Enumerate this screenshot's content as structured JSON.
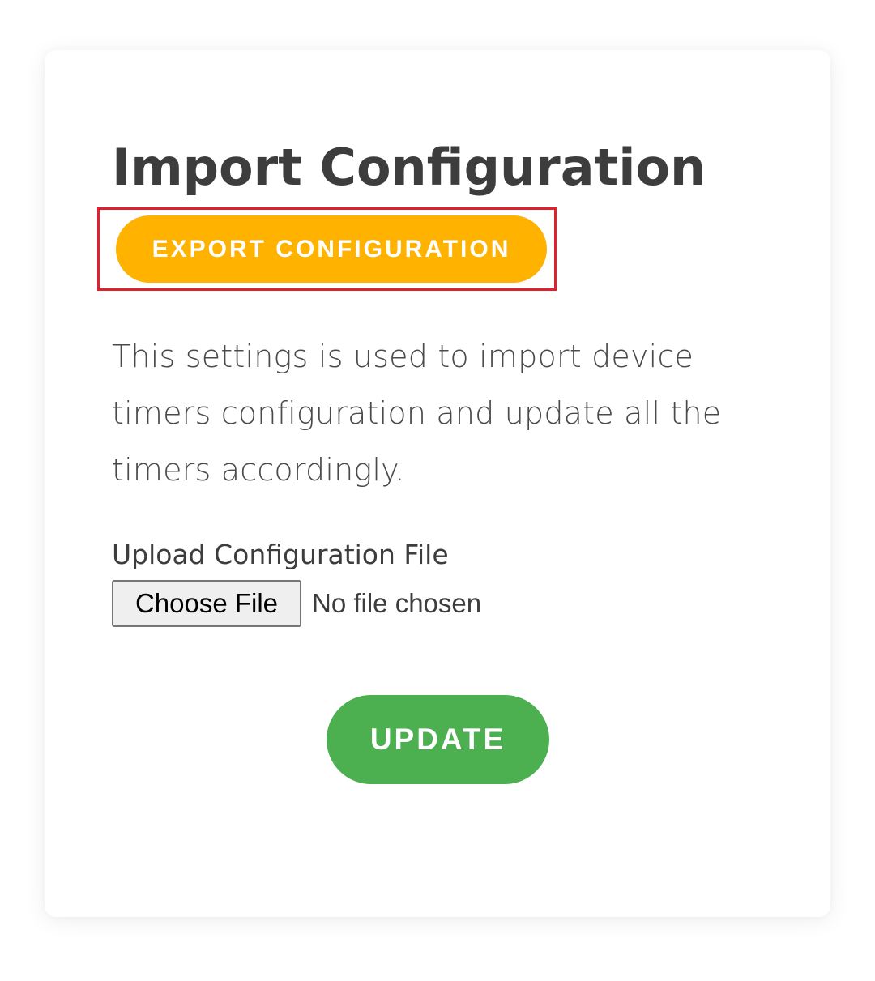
{
  "card": {
    "title": "Import Configuration",
    "export_button_label": "EXPORT CONFIGURATION",
    "description": "This settings is used to import device timers configuration and update all the timers accordingly.",
    "upload_label": "Upload Configuration File",
    "file_input": {
      "choose_button_label": "Choose File",
      "status_text": "No file chosen"
    },
    "update_button_label": "UPDATE"
  },
  "colors": {
    "export_button": "#ffb300",
    "update_button": "#4caf50",
    "highlight_border": "#e0202c",
    "title_text": "#3d3d3d"
  }
}
